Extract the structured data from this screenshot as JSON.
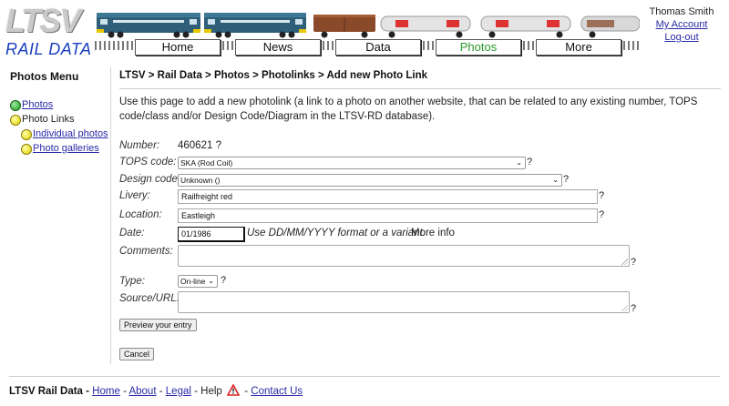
{
  "logo": {
    "top": "LTSV",
    "bottom": "RAIL DATA"
  },
  "nav": [
    {
      "label": "Home",
      "active": false
    },
    {
      "label": "News",
      "active": false
    },
    {
      "label": "Data",
      "active": false
    },
    {
      "label": "Photos",
      "active": true
    },
    {
      "label": "More",
      "active": false
    }
  ],
  "user": {
    "name": "Thomas Smith",
    "account": "My Account",
    "logout": "Log-out"
  },
  "menu": {
    "title": "Photos Menu",
    "items": [
      {
        "label": "Photos",
        "icon": "green-bullet-icon",
        "link": true
      },
      {
        "label": "Photo Links",
        "icon": "yellow-bullet-icon",
        "link": false
      },
      {
        "label": "Individual photos",
        "icon": "yellow-bullet-icon",
        "link": true
      },
      {
        "label": "Photo galleries",
        "icon": "yellow-bullet-icon",
        "link": true
      }
    ]
  },
  "breadcrumb": "LTSV > Rail Data > Photos > Photolinks > Add new Photo Link",
  "intro": "Use this page to add a new photolink (a link to a photo on another website, that can be related to any existing number, TOPS code/class and/or Design Code/Diagram in the LTSV-RD database).",
  "form": {
    "number_label": "Number:",
    "number_value": "460621 ?",
    "tops_label": "TOPS code:",
    "tops_value": "SKA (Rod Coil)",
    "design_label": "Design code:",
    "design_value": "Unknown ()",
    "livery_label": "Livery:",
    "livery_value": "Railfreight red",
    "location_label": "Location:",
    "location_value": "Eastleigh",
    "date_label": "Date:",
    "date_value": "01/1986",
    "date_hint": "Use DD/MM/YYYY format or a variant.",
    "more_info": "More info",
    "comments_label": "Comments:",
    "type_label": "Type:",
    "type_value": "On-line",
    "source_label": "Source/URL:",
    "help_mark": "?",
    "preview_button": "Preview your entry",
    "cancel_button": "Cancel"
  },
  "footer": {
    "site": "LTSV Rail Data -",
    "home": "Home",
    "about": "About",
    "legal": "Legal",
    "help": "Help",
    "contact": "Contact Us",
    "sep": "-"
  },
  "colors": {
    "link": "#2a2aa8",
    "active_nav": "#2d9a2d",
    "logo_blue": "#1a3fbf"
  }
}
